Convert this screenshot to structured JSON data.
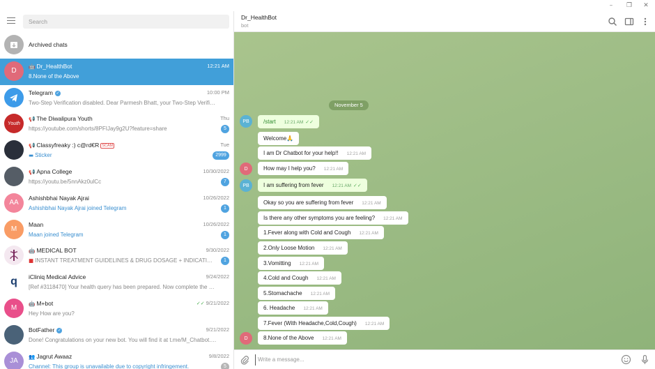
{
  "window": {
    "minimize": "–",
    "maximize": "❐",
    "close": "✕"
  },
  "search": {
    "placeholder": "Search"
  },
  "chats": [
    {
      "name": "Archived chats",
      "initials": "",
      "color": "#b0b0b0",
      "time": "",
      "preview": "",
      "badge": ""
    },
    {
      "name": "Dr_HealthBot",
      "initials": "D",
      "color": "#e06a79",
      "time": "12:21 AM",
      "preview": "8.None of the Above",
      "badge": ""
    },
    {
      "name": "Telegram",
      "initials": "",
      "color": "#3d9be9",
      "time": "10:00 PM",
      "preview": "Two-Step Verification disabled. Dear Parmesh Bhatt, your Two-Step Verificati...",
      "badge": ""
    },
    {
      "name": "The Diwalipura Youth",
      "initials": "",
      "color": "#c62a2a",
      "time": "Thu",
      "preview": "https://youtube.com/shorts/8PFIJay9g2U?feature=share",
      "badge": "5"
    },
    {
      "name": "Classyfreaky :) c@rd€R",
      "initials": "",
      "color": "#2a2f3a",
      "time": "Tue",
      "preview": "Sticker",
      "badge": "2999",
      "scam": "SCAM"
    },
    {
      "name": "Apna College",
      "initials": "",
      "color": "#555d66",
      "time": "10/30/2022",
      "preview": "https://youtu.be/5nnAkz0ulCc",
      "badge": "7"
    },
    {
      "name": "Ashishbhai Nayak Ajrai",
      "initials": "AA",
      "color": "#f3859b",
      "time": "10/26/2022",
      "preview": "Ashishbhai Nayak Ajrai joined Telegram",
      "badge": "1"
    },
    {
      "name": "Maan",
      "initials": "M",
      "color": "#f99c65",
      "time": "10/26/2022",
      "preview": "Maan joined Telegram",
      "badge": "1"
    },
    {
      "name": "MEDICAL BOT",
      "initials": "",
      "color": "#7b2a5e",
      "time": "9/30/2022",
      "preview": "INSTANT TREATMENT GUIDELINES & DRUG DOSAGE + INDICATIONS S...",
      "badge": "1"
    },
    {
      "name": "iCliniq Medical Advice",
      "initials": "",
      "color": "#ffffff",
      "time": "9/24/2022",
      "preview": "[Ref #3118470] Your health query has been prepared.  Now complete the pa...",
      "badge": ""
    },
    {
      "name": "M+bot",
      "initials": "M",
      "color": "#e94f8a",
      "time": "9/21/2022",
      "preview": "Hey How are you?",
      "badge": ""
    },
    {
      "name": "BotFather",
      "initials": "",
      "color": "#4a6278",
      "time": "9/21/2022",
      "preview": "Done! Congratulations on your new bot. You will find it at t.me/M_Chatbot. Y...",
      "badge": ""
    },
    {
      "name": "Jagrut Awaaz",
      "initials": "JA",
      "color": "#a98fd7",
      "time": "9/8/2022",
      "preview": "Channel: This group is unavailable due to copyright infringement.",
      "badge": "5"
    }
  ],
  "header": {
    "name": "Dr_HealthBot",
    "status": "bot"
  },
  "date_pill": "November 5",
  "messages": [
    {
      "text": "/start",
      "time": "12:21 AM",
      "out": true,
      "avatar": "PB"
    },
    {
      "text": "Welcome🙏",
      "time": "",
      "out": false,
      "avatar": ""
    },
    {
      "text": "I am Dr Chatbot for your help!!",
      "time": "12:21 AM",
      "out": false,
      "avatar": ""
    },
    {
      "text": "How may I help you?",
      "time": "12:21 AM",
      "out": false,
      "avatar": "D"
    },
    {
      "text": "I am suffering from fever",
      "time": "12:21 AM",
      "out": true,
      "avatar": "PB"
    },
    {
      "text": "Okay so you are suffering from fever",
      "time": "12:21 AM",
      "out": false,
      "avatar": ""
    },
    {
      "text": "Is there any other symptoms you are feeling?",
      "time": "12:21 AM",
      "out": false,
      "avatar": ""
    },
    {
      "text": "1.Fever along with Cold and Cough",
      "time": "12:21 AM",
      "out": false,
      "avatar": ""
    },
    {
      "text": "2.Only Loose Motion",
      "time": "12:21 AM",
      "out": false,
      "avatar": ""
    },
    {
      "text": "3.Vomitting",
      "time": "12:21 AM",
      "out": false,
      "avatar": ""
    },
    {
      "text": "4.Cold and Cough",
      "time": "12:21 AM",
      "out": false,
      "avatar": ""
    },
    {
      "text": "5.Stomachache",
      "time": "12:21 AM",
      "out": false,
      "avatar": ""
    },
    {
      "text": "6. Headache",
      "time": "12:21 AM",
      "out": false,
      "avatar": ""
    },
    {
      "text": "7.Fever (With Headache,Cold,Cough)",
      "time": "12:21 AM",
      "out": false,
      "avatar": ""
    },
    {
      "text": "8.None of the Above",
      "time": "12:21 AM",
      "out": false,
      "avatar": "D"
    }
  ],
  "composer": {
    "placeholder": "Write a message..."
  },
  "colors": {
    "accent": "#419fd9",
    "chat_bg": "#9ebd86",
    "outgoing_bubble": "#eeffde"
  }
}
